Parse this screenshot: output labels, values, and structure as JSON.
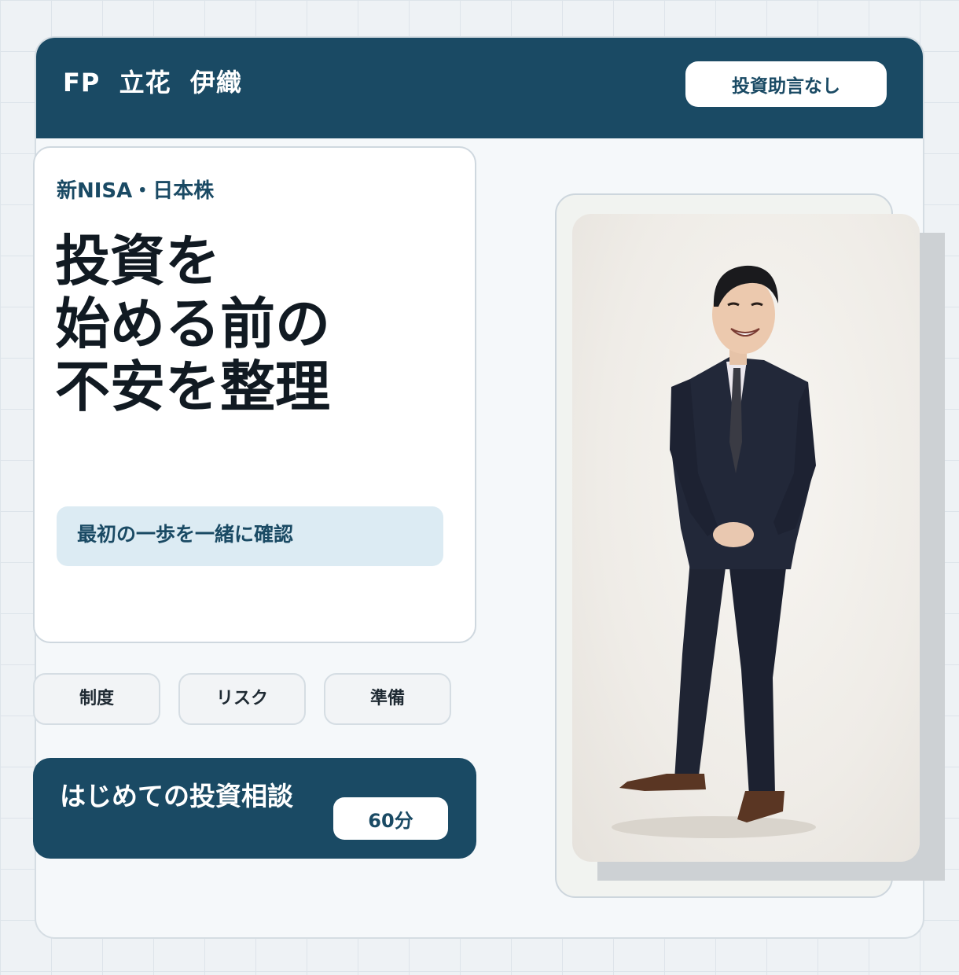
{
  "header": {
    "name": "FP  立花  伊織",
    "badge": "投資助言なし"
  },
  "hero": {
    "kicker": "新NISA・日本株",
    "title_lines": [
      "投資を",
      "始める前の",
      "不安を整理"
    ],
    "pill": "最初の一歩を一緒に確認"
  },
  "tags": [
    "制度",
    "リスク",
    "準備"
  ],
  "cta": {
    "label": "はじめての投資相談",
    "duration": "60分"
  },
  "colors": {
    "primary": "#1a4a64",
    "background": "#eef2f5",
    "pill_bg": "#dcebf3"
  }
}
